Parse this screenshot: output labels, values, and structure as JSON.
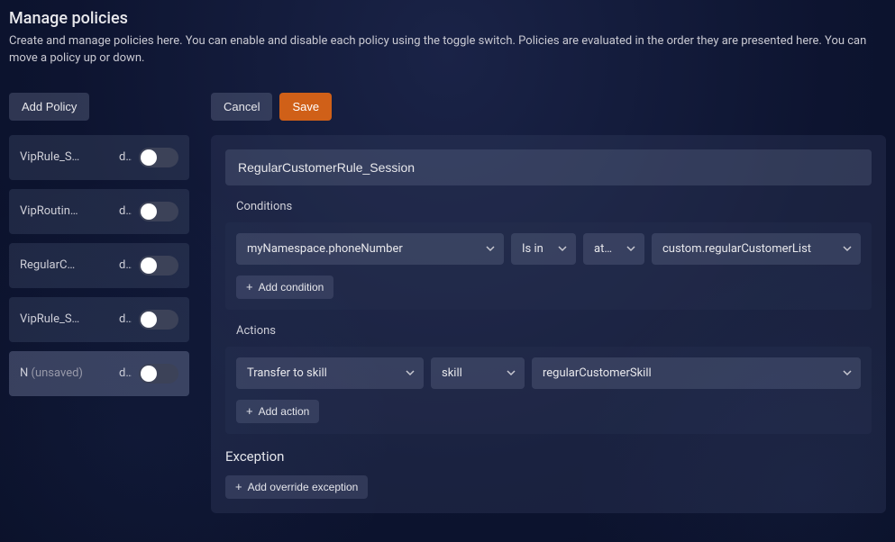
{
  "header": {
    "title": "Manage policies",
    "description": "Create and manage policies here. You can enable and disable each policy using the toggle switch. Policies are evaluated in the order they are presented here. You can move a policy up or down."
  },
  "buttons": {
    "add_policy": "Add Policy",
    "cancel": "Cancel",
    "save": "Save"
  },
  "policies": [
    {
      "name": "VipRule_S…",
      "del": "d…",
      "enabled": false,
      "active": false
    },
    {
      "name": "VipRoutin…",
      "del": "d…",
      "enabled": false,
      "active": false
    },
    {
      "name": "RegularC…",
      "del": "d…",
      "enabled": false,
      "active": false
    },
    {
      "name": "VipRule_S…",
      "del": "d…",
      "enabled": false,
      "active": false
    },
    {
      "name": "N",
      "unsaved": "(unsaved)",
      "del": "d…",
      "enabled": false,
      "active": true
    }
  ],
  "editor": {
    "name": "RegularCustomerRule_Session",
    "conditions_label": "Conditions",
    "conditions": {
      "field": "myNamespace.phoneNumber",
      "operator": "Is in",
      "type": "attr…",
      "value": "custom.regularCustomerList"
    },
    "add_condition": "Add condition",
    "actions_label": "Actions",
    "actions": {
      "action": "Transfer to skill",
      "type": "skill",
      "value": "regularCustomerSkill"
    },
    "add_action": "Add action",
    "exception_label": "Exception",
    "add_exception": "Add override exception"
  }
}
